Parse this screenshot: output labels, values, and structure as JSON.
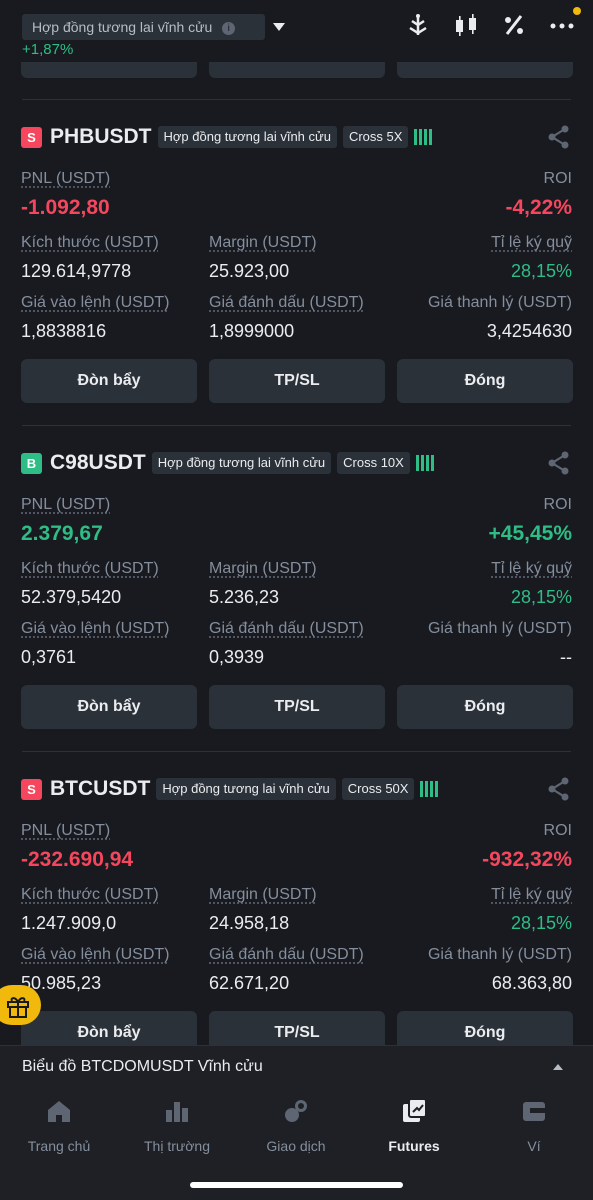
{
  "header": {
    "contract_label": "Hợp đồng tương lai vĩnh cửu",
    "info_glyph": "i",
    "change": "+1,87%",
    "icons": [
      "tree-icon",
      "candlestick-icon",
      "percent-icon",
      "more-icon"
    ]
  },
  "positions": [
    {
      "side": "S",
      "side_color": "#f6465d",
      "symbol": "PHBUSDT",
      "contract_type": "Hợp đồng tương lai vĩnh cửu",
      "margin_mode": "Cross 5X",
      "pnl_label": "PNL (USDT)",
      "pnl": "-1.092,80",
      "roi_label": "ROI",
      "roi": "-4,22%",
      "size_label": "Kích thước (USDT)",
      "size": "129.614,9778",
      "margin_label": "Margin (USDT)",
      "margin": "25.923,00",
      "margin_ratio_label": "Tỉ lệ ký quỹ",
      "margin_ratio": "28,15%",
      "entry_label": "Giá vào lệnh (USDT)",
      "entry": "1,8838816",
      "mark_label": "Giá đánh dấu (USDT)",
      "mark": "1,8999000",
      "liq_label": "Giá thanh lý (USDT)",
      "liq": "3,4254630",
      "btn_leverage": "Đòn bẩy",
      "btn_tpsl": "TP/SL",
      "btn_close": "Đóng"
    },
    {
      "side": "B",
      "side_color": "#2ebd85",
      "symbol": "C98USDT",
      "contract_type": "Hợp đồng tương lai vĩnh cửu",
      "margin_mode": "Cross 10X",
      "pnl_label": "PNL (USDT)",
      "pnl": "2.379,67",
      "roi_label": "ROI",
      "roi": "+45,45%",
      "size_label": "Kích thước (USDT)",
      "size": "52.379,5420",
      "margin_label": "Margin (USDT)",
      "margin": "5.236,23",
      "margin_ratio_label": "Tỉ lệ ký quỹ",
      "margin_ratio": "28,15%",
      "entry_label": "Giá vào lệnh (USDT)",
      "entry": "0,3761",
      "mark_label": "Giá đánh dấu (USDT)",
      "mark": "0,3939",
      "liq_label": "Giá thanh lý (USDT)",
      "liq": "--",
      "btn_leverage": "Đòn bẩy",
      "btn_tpsl": "TP/SL",
      "btn_close": "Đóng"
    },
    {
      "side": "S",
      "side_color": "#f6465d",
      "symbol": "BTCUSDT",
      "contract_type": "Hợp đồng tương lai vĩnh cửu",
      "margin_mode": "Cross 50X",
      "pnl_label": "PNL (USDT)",
      "pnl": "-232.690,94",
      "roi_label": "ROI",
      "roi": "-932,32%",
      "size_label": "Kích thước (USDT)",
      "size": "1.247.909,0",
      "margin_label": "Margin (USDT)",
      "margin": "24.958,18",
      "margin_ratio_label": "Tỉ lệ ký quỹ",
      "margin_ratio": "28,15%",
      "entry_label": "Giá vào lệnh (USDT)",
      "entry": "50.985,23",
      "mark_label": "Giá đánh dấu (USDT)",
      "mark": "62.671,20",
      "liq_label": "Giá thanh lý (USDT)",
      "liq": "68.363,80",
      "btn_leverage": "Đòn bẩy",
      "btn_tpsl": "TP/SL",
      "btn_close": "Đóng"
    }
  ],
  "chart_bar": {
    "label": "Biểu đồ BTCDOMUSDT Vĩnh cửu"
  },
  "nav": {
    "items": [
      {
        "label": "Trang chủ",
        "icon": "home-icon"
      },
      {
        "label": "Thị trường",
        "icon": "market-icon"
      },
      {
        "label": "Giao dịch",
        "icon": "trade-icon"
      },
      {
        "label": "Futures",
        "icon": "futures-icon",
        "active": true
      },
      {
        "label": "Ví",
        "icon": "wallet-icon"
      }
    ]
  },
  "colors": {
    "background": "#181a20",
    "panel": "#2b3139",
    "up": "#2ebd85",
    "down": "#f6465d",
    "accent": "#f0b90b"
  }
}
